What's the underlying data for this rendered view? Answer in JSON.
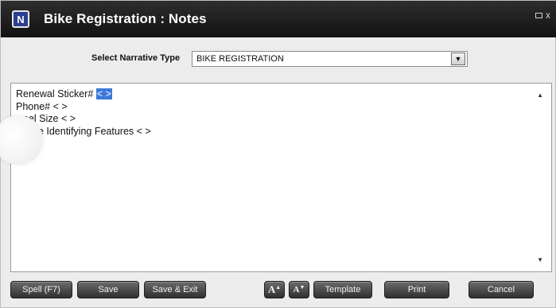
{
  "window": {
    "title": "Bike Registration : Notes",
    "app_icon_glyph": "N",
    "controls": {
      "restore_label": "",
      "close_label": "x"
    }
  },
  "narrative": {
    "label": "Select Narrative Type",
    "selected": "BIKE REGISTRATION"
  },
  "notes": {
    "line1_text": "Renewal Sticker# ",
    "line1_highlight": "< >",
    "line2": "Phone# < >",
    "line3": "eel Size < >",
    "line4": "ue Identifying Features < >"
  },
  "buttons": {
    "spell": "Spell (F7)",
    "save": "Save",
    "save_exit": "Save & Exit",
    "font_up": "A",
    "font_down": "A",
    "template": "Template",
    "print": "Print",
    "cancel": "Cancel"
  }
}
